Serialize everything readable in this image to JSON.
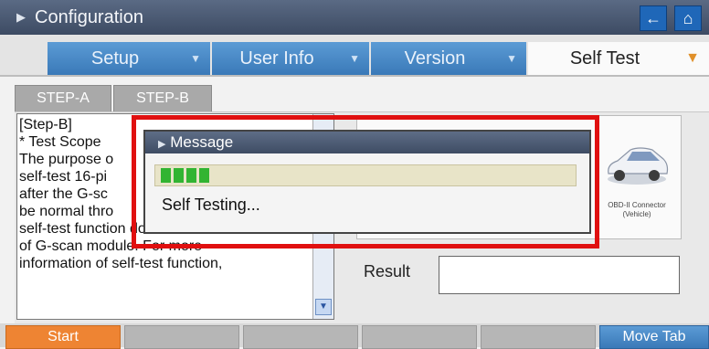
{
  "window": {
    "title": "Configuration",
    "back_icon": "back-arrow-icon",
    "home_icon": "home-icon"
  },
  "tabs": [
    {
      "label": "Setup"
    },
    {
      "label": "User Info"
    },
    {
      "label": "Version"
    },
    {
      "label": "Self Test",
      "active": true
    }
  ],
  "steps": [
    {
      "label": "STEP-A"
    },
    {
      "label": "STEP-B",
      "active": true
    }
  ],
  "description": {
    "lines": [
      "[Step-B]",
      "* Test Scope",
      "The purpose o",
      "self-test 16-pi",
      "after the G-sc",
      "be normal thro",
      "self-test function does not test all",
      "of G-scan module. For more",
      "information of self-test function,"
    ]
  },
  "diagram": {
    "car_label": "OBD-II Connector (Vehicle)"
  },
  "result": {
    "label": "Result",
    "value": ""
  },
  "dialog": {
    "title": "Message",
    "message": "Self Testing...",
    "progress_segments": 4
  },
  "bottom": {
    "start_label": "Start",
    "move_tab_label": "Move Tab"
  },
  "colors": {
    "accent_blue": "#3a79b8",
    "highlight_red": "#e01010",
    "progress_green": "#32b432",
    "start_orange": "#ee8433"
  }
}
